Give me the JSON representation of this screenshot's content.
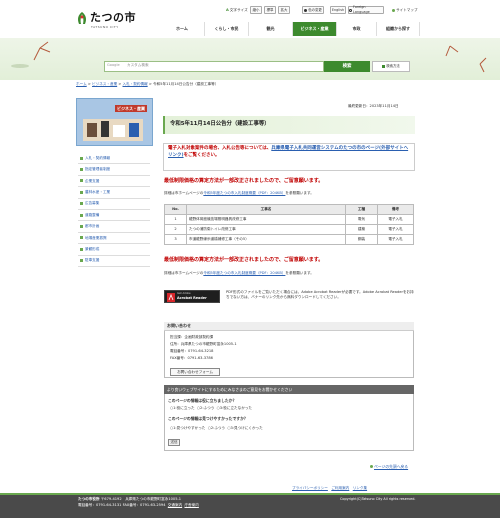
{
  "header": {
    "logo_text": "たつの市",
    "logo_sub": "TATSUNO CITY",
    "font_size_label": "文字サイズ",
    "font_small": "縮小",
    "font_standard": "標準",
    "font_large": "拡大",
    "color_label": "色の変更",
    "english": "English",
    "foreign_language": "Foreign Language",
    "sitemap": "サイトマップ"
  },
  "nav": [
    "ホーム",
    "くらし・市民",
    "観光",
    "ビジネス・産業",
    "市政",
    "組織から探す"
  ],
  "search": {
    "google": "Google",
    "placeholder": "カスタム検索",
    "button": "検索",
    "detail": "検索方法"
  },
  "breadcrumb": {
    "home": "ホーム",
    "business": "ビジネス・産業",
    "bid": "入札・契約情報",
    "current": "令和5年11月14日公告分（建設工事等）",
    "sep": ">"
  },
  "sidebar": {
    "banner_label": "ビジネス・産業",
    "items": [
      "入札・契約情報",
      "指定管理者制度",
      "企業支援",
      "農林水産・工業",
      "広告募集",
      "道路整備",
      "都市計画",
      "地場産業振興",
      "景観形成",
      "駐車支援"
    ]
  },
  "content": {
    "updated": "最終更新日：2023年11月14日",
    "title": "令和5年11月14日公告分（建設工事等）",
    "notice_pre": "電子入札対象案件の場合、入札公告等については、",
    "notice_link": "兵庫県電子入札共同運営システムのたつの市のページ(外部サイトへリンク)",
    "notice_post": "をご覧ください。",
    "warn1": "最低制限価格の算定方法が一部改正されましたので、ご留意願います。",
    "detail1_pre": "詳細は市ホームページの",
    "detail1_link": "令和5年度たつの市入札制度概要（PDF：204KB）",
    "detail1_post": "を参照願います。",
    "warn2": "最低制限価格の算定方法が一部改正されましたので、ご留意願います。",
    "detail2_pre": "詳細は市ホームページの",
    "detail2_link": "令和5年度たつの市入札制度概要（PDF：204KB）",
    "detail2_post": "を参照願います。"
  },
  "table": {
    "headers": [
      "No.",
      "工事名",
      "工種",
      "備考"
    ],
    "rows": [
      [
        "1",
        "龍野体育館競技場照明器具改修工事",
        "電気",
        "電子入札"
      ],
      [
        "2",
        "たつの浦防衛トイレ改修工事",
        "建築",
        "電子入札"
      ],
      [
        "3",
        "市道龍野線歩道橋補修工事（その5）",
        "鋼装",
        "電子入札"
      ]
    ]
  },
  "acrobat": {
    "img_label1": "Get Adobe",
    "img_label2": "Acrobat Reader",
    "text": "PDF形式のファイルをご覧いただく場合には、Adobe Acrobat Readerが必要です。Adobe Acrobat Readerをお持ちでない方は、バナーのリンク先から無料ダウンロードしてください。"
  },
  "contact": {
    "head": "お問い合わせ",
    "dept": "担当課：企画財政部契約課",
    "addr": "住所：兵庫県たつの市龍野町富永1005-1",
    "tel": "電話番号：0791-64-3218",
    "fax": "FAX番号：0791-63-3786",
    "button": "お問い合わせフォーム"
  },
  "survey": {
    "head": "より良いウェブサイトにするためにみなさまのご意見をお聞かせください",
    "q1": "このページの情報は役に立ちましたか？",
    "q1_opts": [
      "1:役に立った",
      "2:ふつう",
      "3:役に立たなかった"
    ],
    "q2": "このページの情報は見つけやすかったですか？",
    "q2_opts": [
      "1:見つけやすかった",
      "2:ふつう",
      "3:見つけにくかった"
    ],
    "send": "送信"
  },
  "footer": {
    "pagetop": "ページの先頭へ戻る",
    "privacy": "プライバシーポリシー",
    "usage": "ご利用案内",
    "link": "リンク集",
    "copyright": "Copyright(C)Tatsuno City All rights reserved.",
    "city": "たつの市役所",
    "addr": "〒679-4192　兵庫県たつの市龍野町富永1005-1",
    "tel": "電話番号：0791-64-3131",
    "fax": "FAX番号：0791-63-2594",
    "access": "交通案内",
    "hours": "庁舎案内"
  },
  "colors": {
    "accent": "#6aa84f",
    "link": "#2a5fb0",
    "warn": "#c00000",
    "search": "#3d8a2e"
  }
}
